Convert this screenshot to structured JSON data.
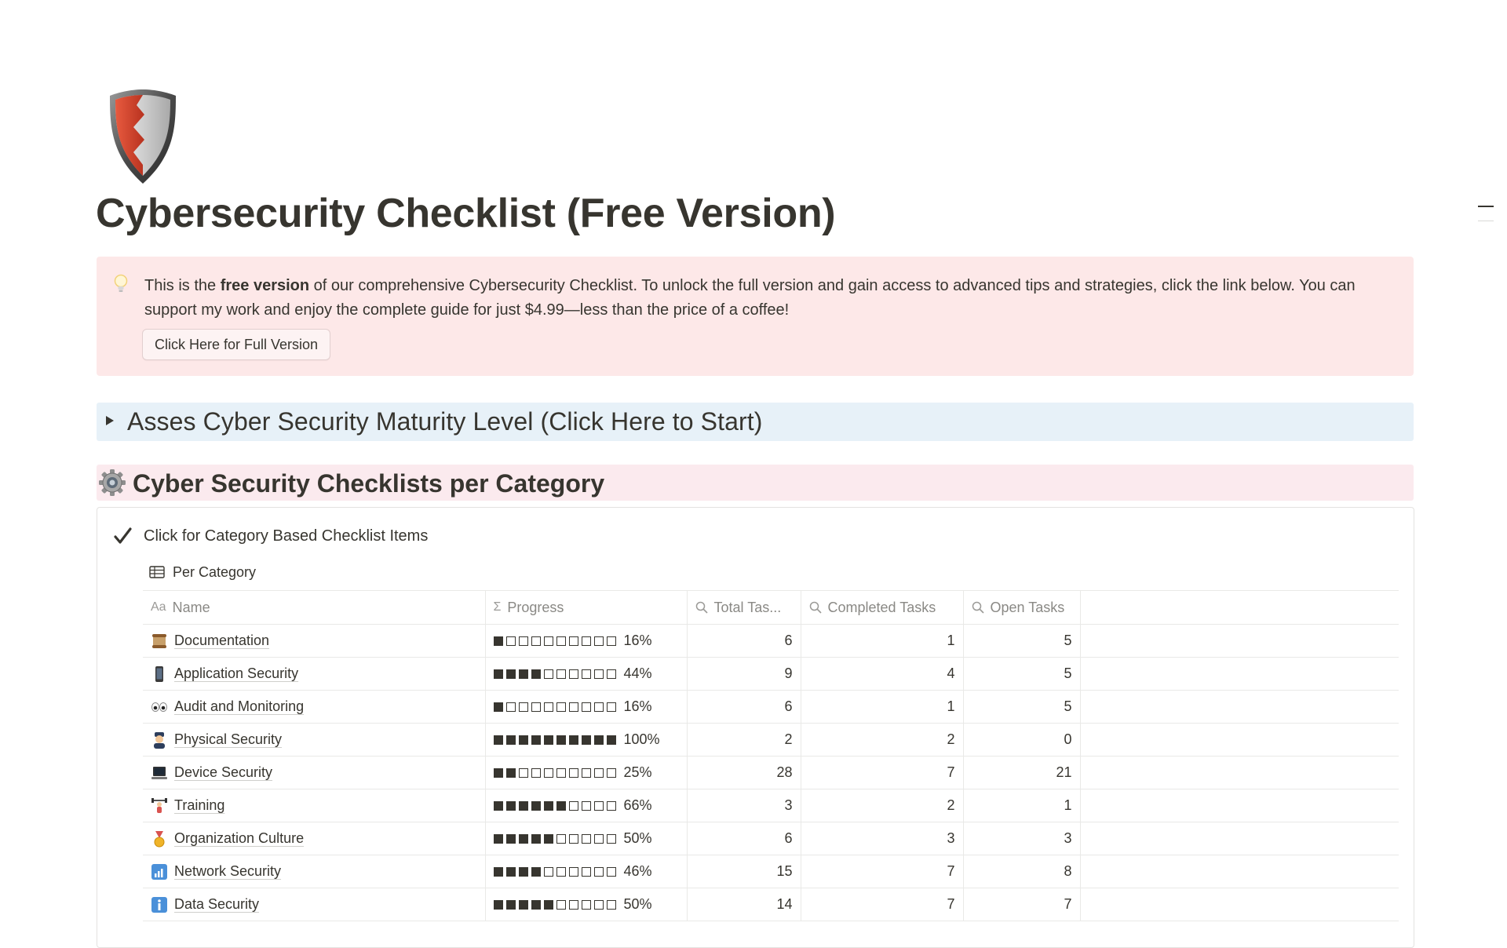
{
  "page": {
    "title": "Cybersecurity Checklist (Free Version)",
    "icon": "shield-icon"
  },
  "callout": {
    "icon": "lightbulb-icon",
    "text_before": "This is the ",
    "text_bold": "free version",
    "text_after": " of our comprehensive Cybersecurity Checklist. To unlock the full version and gain access to advanced tips and strategies, click the link below. You can support my work and enjoy the complete guide for just $4.99—less than the price of a coffee!",
    "button_label": "Click Here for Full Version",
    "background": "#fde8e8"
  },
  "toggle_heading": {
    "label": "Asses Cyber Security Maturity Level (Click Here to Start)",
    "background": "#e7f1f8",
    "collapsed": true
  },
  "section": {
    "icon": "gear-icon",
    "title": "Cyber Security Checklists per Category",
    "background": "#fbeaee"
  },
  "panel": {
    "icon": "checkmark-icon",
    "label": "Click for Category Based Checklist Items"
  },
  "database": {
    "view_label": "Per Category",
    "view_icon": "table-icon",
    "columns": [
      {
        "label": "Name",
        "icon": "Aa"
      },
      {
        "label": "Progress",
        "icon": "Σ"
      },
      {
        "label": "Total Tas...",
        "icon": "search-icon"
      },
      {
        "label": "Completed Tasks",
        "icon": "search-icon"
      },
      {
        "label": "Open Tasks",
        "icon": "search-icon"
      }
    ],
    "rows": [
      {
        "icon": "scroll-icon",
        "name": "Documentation",
        "progress_filled": 1,
        "progress_text": "16%",
        "total": "6",
        "completed": "1",
        "open": "5"
      },
      {
        "icon": "mobile-phone-icon",
        "name": "Application Security",
        "progress_filled": 4,
        "progress_text": "44%",
        "total": "9",
        "completed": "4",
        "open": "5"
      },
      {
        "icon": "eyes-icon",
        "name": "Audit and Monitoring",
        "progress_filled": 1,
        "progress_text": "16%",
        "total": "6",
        "completed": "1",
        "open": "5"
      },
      {
        "icon": "police-officer-icon",
        "name": "Physical Security",
        "progress_filled": 10,
        "progress_text": "100%",
        "total": "2",
        "completed": "2",
        "open": "0"
      },
      {
        "icon": "laptop-icon",
        "name": "Device Security",
        "progress_filled": 2,
        "progress_text": "25%",
        "total": "28",
        "completed": "7",
        "open": "21"
      },
      {
        "icon": "weightlifter-icon",
        "name": "Training",
        "progress_filled": 6,
        "progress_text": "66%",
        "total": "3",
        "completed": "2",
        "open": "1"
      },
      {
        "icon": "medal-icon",
        "name": "Organization Culture",
        "progress_filled": 5,
        "progress_text": "50%",
        "total": "6",
        "completed": "3",
        "open": "3"
      },
      {
        "icon": "signal-bars-icon",
        "name": "Network Security",
        "progress_filled": 4,
        "progress_text": "46%",
        "total": "15",
        "completed": "7",
        "open": "8"
      },
      {
        "icon": "information-icon",
        "name": "Data Security",
        "progress_filled": 5,
        "progress_text": "50%",
        "total": "14",
        "completed": "7",
        "open": "7"
      }
    ],
    "progress_total_squares": 10
  }
}
